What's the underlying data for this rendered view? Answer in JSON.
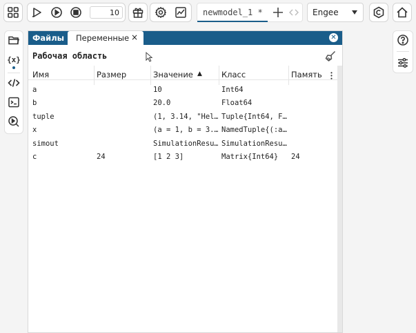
{
  "toolbar": {
    "step_value": "10",
    "model_tab_label": "newmodel_1 *",
    "engine_select_value": "Engee"
  },
  "panel": {
    "tab_files": "Файлы",
    "tab_variables": "Переменные",
    "tab_close": "×",
    "workspace_title": "Рабочая область",
    "columns": [
      "Имя",
      "Размер",
      "Значение",
      "Класс",
      "Память"
    ],
    "sort_indicator": "▲",
    "rows": [
      {
        "name": "a",
        "size": "",
        "value": "10",
        "class": "Int64",
        "memory": ""
      },
      {
        "name": "b",
        "size": "",
        "value": "20.0",
        "class": "Float64",
        "memory": ""
      },
      {
        "name": "tuple",
        "size": "",
        "value": "(1, 3.14, \"Hel…",
        "class": "Tuple{Int64, F…",
        "memory": ""
      },
      {
        "name": "x",
        "size": "",
        "value": "(a = 1, b = 3.…",
        "class": "NamedTuple{(:a…",
        "memory": ""
      },
      {
        "name": "simout",
        "size": "",
        "value": "SimulationResu…",
        "class": "SimulationResu…",
        "memory": ""
      },
      {
        "name": "c",
        "size": "24",
        "value": "[1 2 3]",
        "class": "Matrix{Int64}",
        "memory": "24"
      }
    ]
  },
  "colors": {
    "tab_bar": "#1a5d8a",
    "active_tab_underline": "#1a5d8a"
  }
}
